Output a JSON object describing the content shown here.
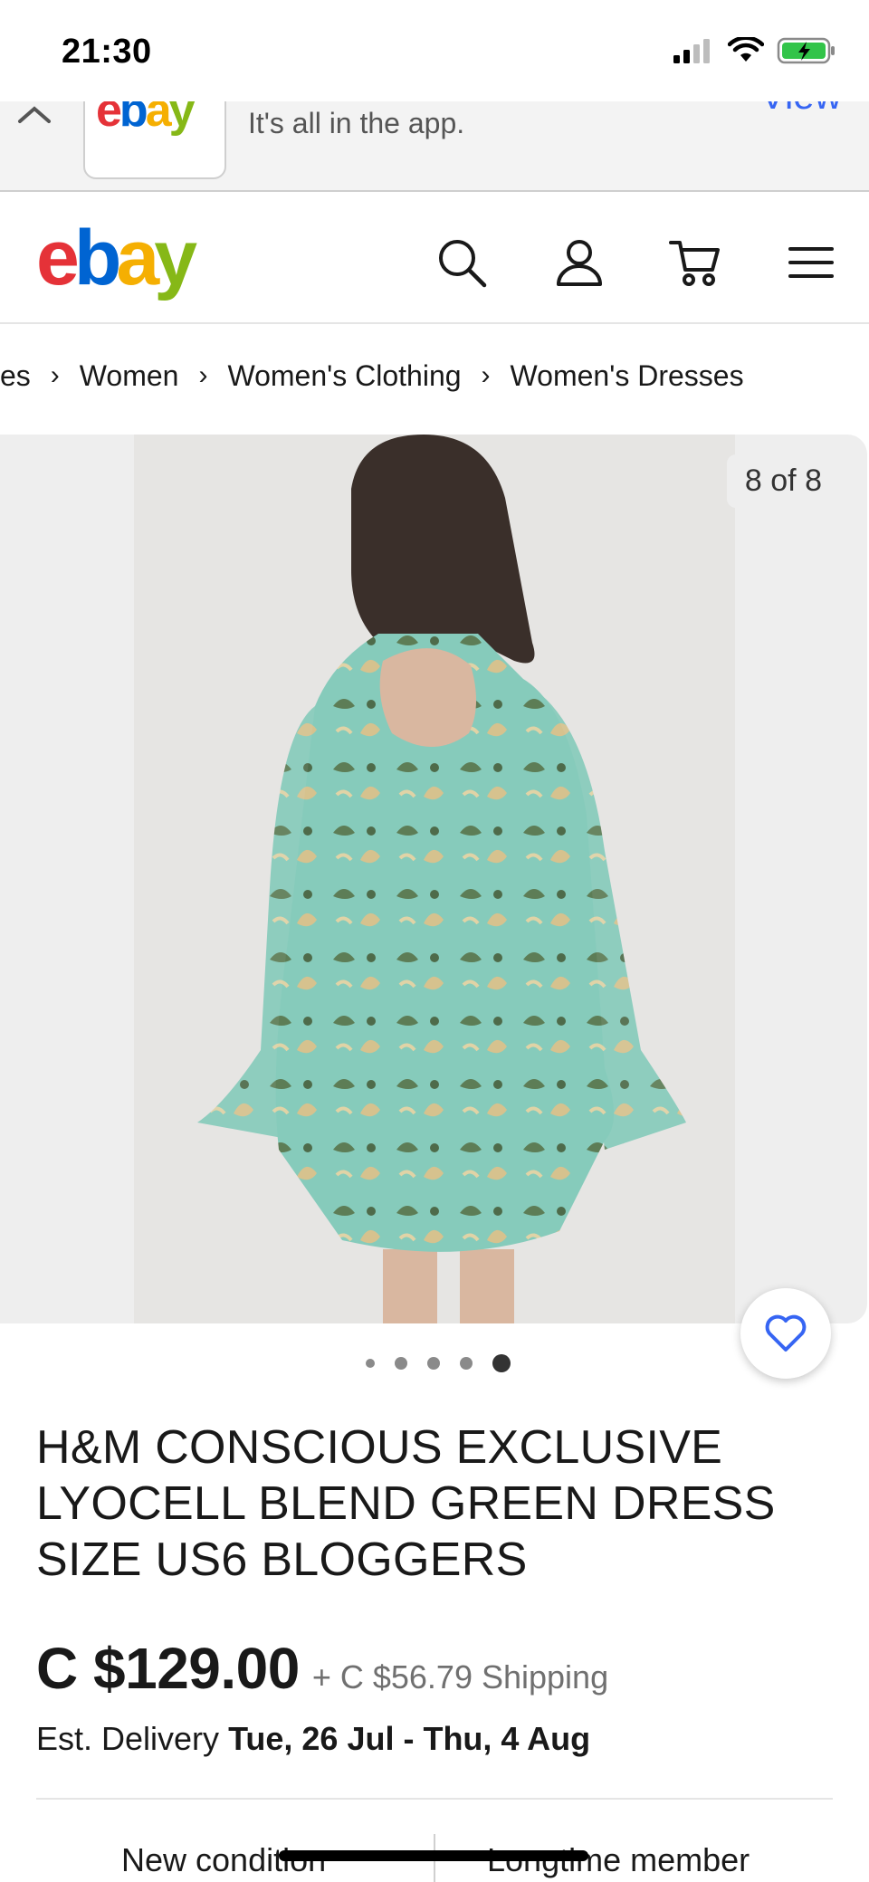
{
  "status": {
    "time": "21:30"
  },
  "banner": {
    "text": "It's all in the app.",
    "view_label": "View",
    "logo_text": "ebay"
  },
  "header": {
    "logo": {
      "e": "e",
      "b": "b",
      "a": "a",
      "y": "y"
    }
  },
  "breadcrumb": [
    "es",
    "Women",
    "Women's Clothing",
    "Women's Dresses"
  ],
  "gallery": {
    "counter": "8 of 8",
    "dots": 5,
    "active_dot": 4
  },
  "listing": {
    "title": "H&M CONSCIOUS EXCLUSIVE LYOCELL BLEND GREEN DRESS SIZE US6 BLOGGERS",
    "price": "C $129.00",
    "shipping": "+ C $56.79 Shipping",
    "delivery_label": "Est. Delivery",
    "delivery_dates": "Tue, 26 Jul - Thu, 4 Aug"
  },
  "highlights": {
    "left": "New condition",
    "right": "Longtime member"
  },
  "colors": {
    "accent": "#3665f3",
    "logo_red": "#e53238",
    "logo_blue": "#0064d2",
    "logo_yellow": "#f5af02",
    "logo_green": "#86b817",
    "dress": "#7fc8b8"
  },
  "icons": {
    "search": "search-icon",
    "account": "user-icon",
    "cart": "cart-icon",
    "menu": "menu-icon",
    "favorite": "heart-icon",
    "close": "chevron-up-icon",
    "chevron": "chevron-right-icon"
  }
}
